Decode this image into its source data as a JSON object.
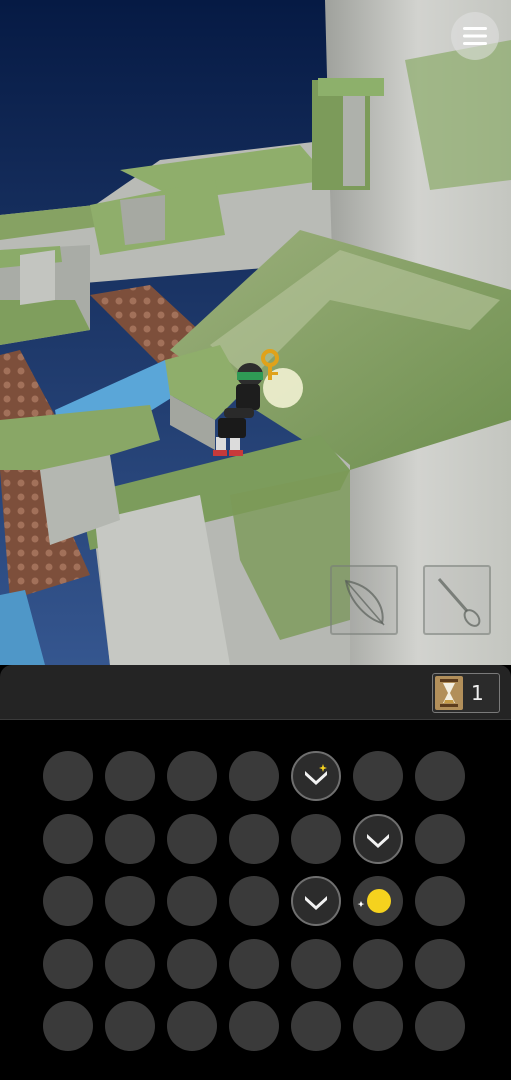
{
  "game": {
    "menu_icon": "hamburger-menu-icon",
    "tools": [
      {
        "name": "feather-icon"
      },
      {
        "name": "brush-icon"
      }
    ],
    "inventory": {
      "hourglass_icon": "hourglass-icon",
      "hourglass_count": "1"
    },
    "grid": {
      "rows": 5,
      "cols": 7,
      "cells": [
        [
          "empty",
          "empty",
          "empty",
          "empty",
          "chevron-sparkle",
          "empty",
          "empty"
        ],
        [
          "empty",
          "empty",
          "empty",
          "empty",
          "empty",
          "chevron",
          "empty"
        ],
        [
          "empty",
          "empty",
          "empty",
          "empty",
          "chevron",
          "player-orb",
          "empty"
        ],
        [
          "empty",
          "empty",
          "empty",
          "empty",
          "empty",
          "empty",
          "empty"
        ],
        [
          "empty",
          "empty",
          "empty",
          "empty",
          "empty",
          "empty",
          "empty"
        ]
      ]
    },
    "colors": {
      "sky_top": "#05163a",
      "sky_bottom": "#2e4f8a",
      "moss": "#7ea05c",
      "stone": "#b8bab5",
      "water": "#5aa6d8",
      "brick": "#8a5a44",
      "orb": "#f5d21e",
      "panel": "#242424"
    }
  }
}
